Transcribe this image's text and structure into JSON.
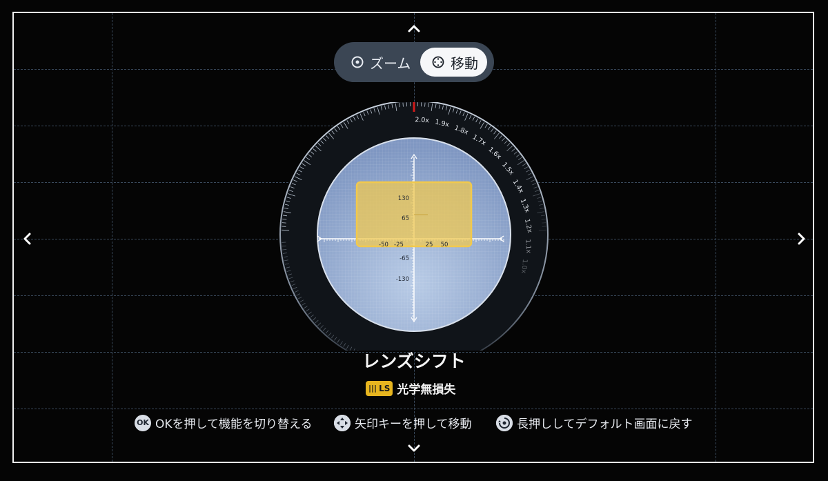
{
  "mode_toggle": {
    "zoom_label": "ズーム",
    "move_label": "移動",
    "selected": "移動"
  },
  "dial": {
    "zoom_ticks": [
      "2.0x",
      "1.9x",
      "1.8x",
      "1.7x",
      "1.6x",
      "1.5x",
      "1.4x",
      "1.3x",
      "1.2x",
      "1.1x",
      "1.0x"
    ],
    "current_zoom": "2.0x",
    "axis": {
      "y_labels": [
        "130",
        "65",
        "-65",
        "-130"
      ],
      "x_labels": [
        "-50",
        "-25",
        "25",
        "50"
      ]
    },
    "colors": {
      "indicator": "#d11a1a",
      "image_box": "#f2c94c",
      "lens": "#9bb3d9"
    }
  },
  "title": "レンズシフト",
  "badge": {
    "mark": "|||",
    "code": "LS",
    "text": "光学無損失"
  },
  "hints": [
    {
      "icon": "ok-icon",
      "icon_text": "OK",
      "text": "OKを押して機能を切り替える"
    },
    {
      "icon": "dpad-icon",
      "icon_text": "",
      "text": "矢印キーを押して移動"
    },
    {
      "icon": "long-press-icon",
      "icon_text": "",
      "text": "長押ししてデフォルト画面に戻す"
    }
  ],
  "nav_icons": [
    "arrow-up-icon",
    "arrow-down-icon",
    "arrow-left-icon",
    "arrow-right-icon"
  ]
}
